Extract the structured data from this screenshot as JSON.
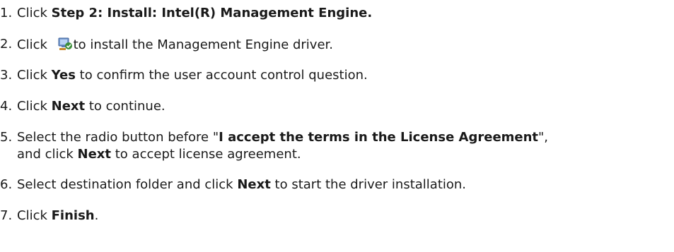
{
  "steps": [
    {
      "number": "1.",
      "text_before": "Click ",
      "bold": "Step 2: Install: Intel(R) Management Engine.",
      "text_after": ""
    },
    {
      "number": "2.",
      "text_before": "Click ",
      "icon": "installer-icon",
      "text_after": "to install the Management Engine driver."
    },
    {
      "number": "3.",
      "text_before": "Click ",
      "bold": "Yes",
      "text_after": " to confirm the user account control question."
    },
    {
      "number": "4.",
      "text_before": "Click ",
      "bold": "Next",
      "text_after": " to continue."
    },
    {
      "number": "5.",
      "text_before": "Select the radio button before \"",
      "bold": "I accept the terms in the License Agreement",
      "text_after": "\",",
      "line2_before": "and click ",
      "line2_bold": "Next",
      "line2_after": " to accept license agreement."
    },
    {
      "number": "6.",
      "text_before": "Select destination folder and click ",
      "bold": "Next",
      "text_after": " to start the driver installation."
    },
    {
      "number": "7.",
      "text_before": "Click ",
      "bold": "Finish",
      "text_after": "."
    }
  ]
}
